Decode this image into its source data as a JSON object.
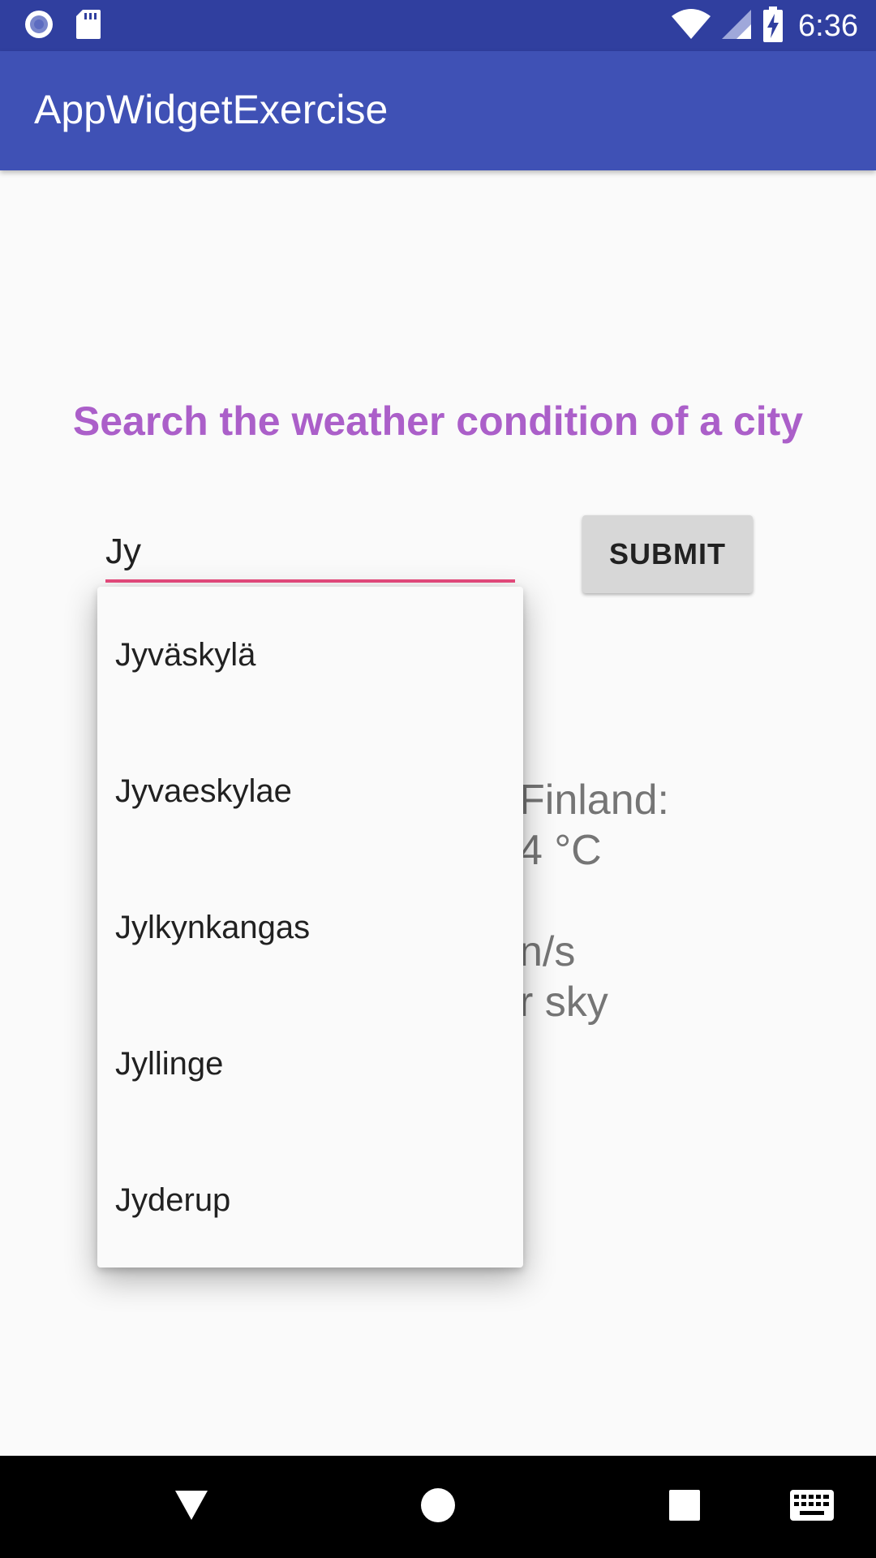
{
  "status_bar": {
    "time": "6:36",
    "icons": [
      "notification-dot-icon",
      "sd-card-icon",
      "wifi-icon",
      "cell-signal-icon",
      "battery-charging-icon"
    ]
  },
  "app_bar": {
    "title": "AppWidgetExercise"
  },
  "main": {
    "headline": "Search the weather condition of a city",
    "search_input_value": "Jy",
    "submit_label": "SUBMIT",
    "result_lines": [
      "Finland:",
      "4 °C",
      "n/s",
      "r sky"
    ]
  },
  "dropdown": {
    "items": [
      "Jyväskylä",
      "Jyvaeskylae",
      "Jylkynkangas",
      "Jyllinge",
      "Jyderup"
    ]
  },
  "nav_bar": {
    "icons": [
      "back-icon",
      "home-icon",
      "recents-icon",
      "keyboard-icon"
    ]
  },
  "colors": {
    "status_bar": "#303f9f",
    "app_bar": "#3f51b5",
    "headline": "#ab5fc9",
    "input_underline": "#e94b7e",
    "button_bg": "#d7d7d7"
  }
}
